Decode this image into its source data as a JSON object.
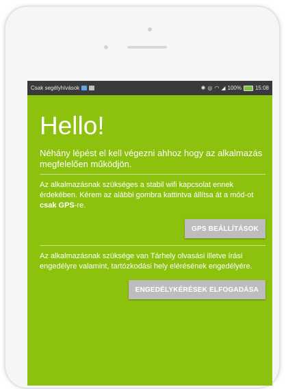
{
  "status_bar": {
    "carrier_text": "Csak segélyhívások",
    "battery_percent": "100%",
    "time": "15:08"
  },
  "screen": {
    "title": "Hello!",
    "intro": "Néhány lépést el kell végezni ahhoz hogy az alkalmazás megfelelően működjön.",
    "section1": {
      "text_before": "Az alkalmazásnak szükséges a stabil wifi kapcsolat ennek érdekében. Kérem az alábbi gombra kattintva állítsa át a mód-ot ",
      "text_bold": "csak GPS",
      "text_after": "-re.",
      "button_label": "GPS BEÁLLÍTÁSOK"
    },
    "section2": {
      "text": "Az alkalmazásnak szüksége van Tárhely olvasási illetve írási engedélyre valamint, tartózkodási hely elérésének engedélyére.",
      "button_label": "ENGEDÉLYKÉRÉSEK ELFOGADÁSA"
    }
  },
  "colors": {
    "screen_background": "#8cc20e",
    "status_bar": "#3a3a3a",
    "button": "#bdbdbd"
  }
}
